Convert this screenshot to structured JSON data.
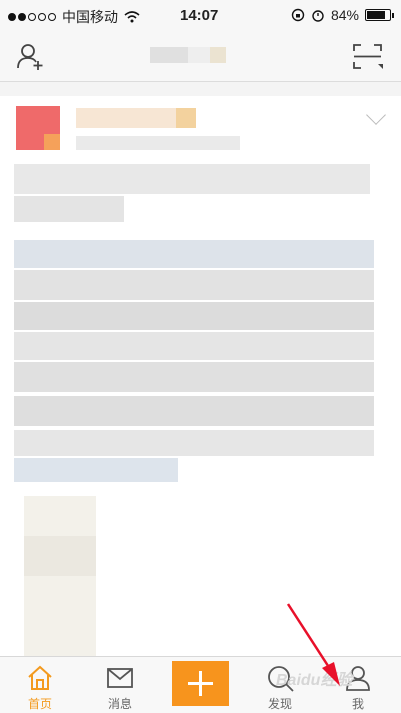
{
  "status_bar": {
    "carrier": "中国移动",
    "time": "14:07",
    "battery": "84%",
    "battery_level": 0.84
  },
  "nav": {
    "add_friend_icon": "add-user-icon",
    "scan_icon": "scan-icon"
  },
  "tabs": [
    {
      "label": "首页",
      "icon": "home-icon",
      "active": true
    },
    {
      "label": "消息",
      "icon": "mail-icon",
      "active": false
    },
    {
      "label": "",
      "icon": "plus-icon",
      "active": false
    },
    {
      "label": "发现",
      "icon": "search-icon",
      "active": false
    },
    {
      "label": "我",
      "icon": "profile-icon",
      "active": false
    }
  ],
  "watermark": "Baidu经验",
  "colors": {
    "accent": "#f7941d",
    "arrow": "#e8102a"
  }
}
